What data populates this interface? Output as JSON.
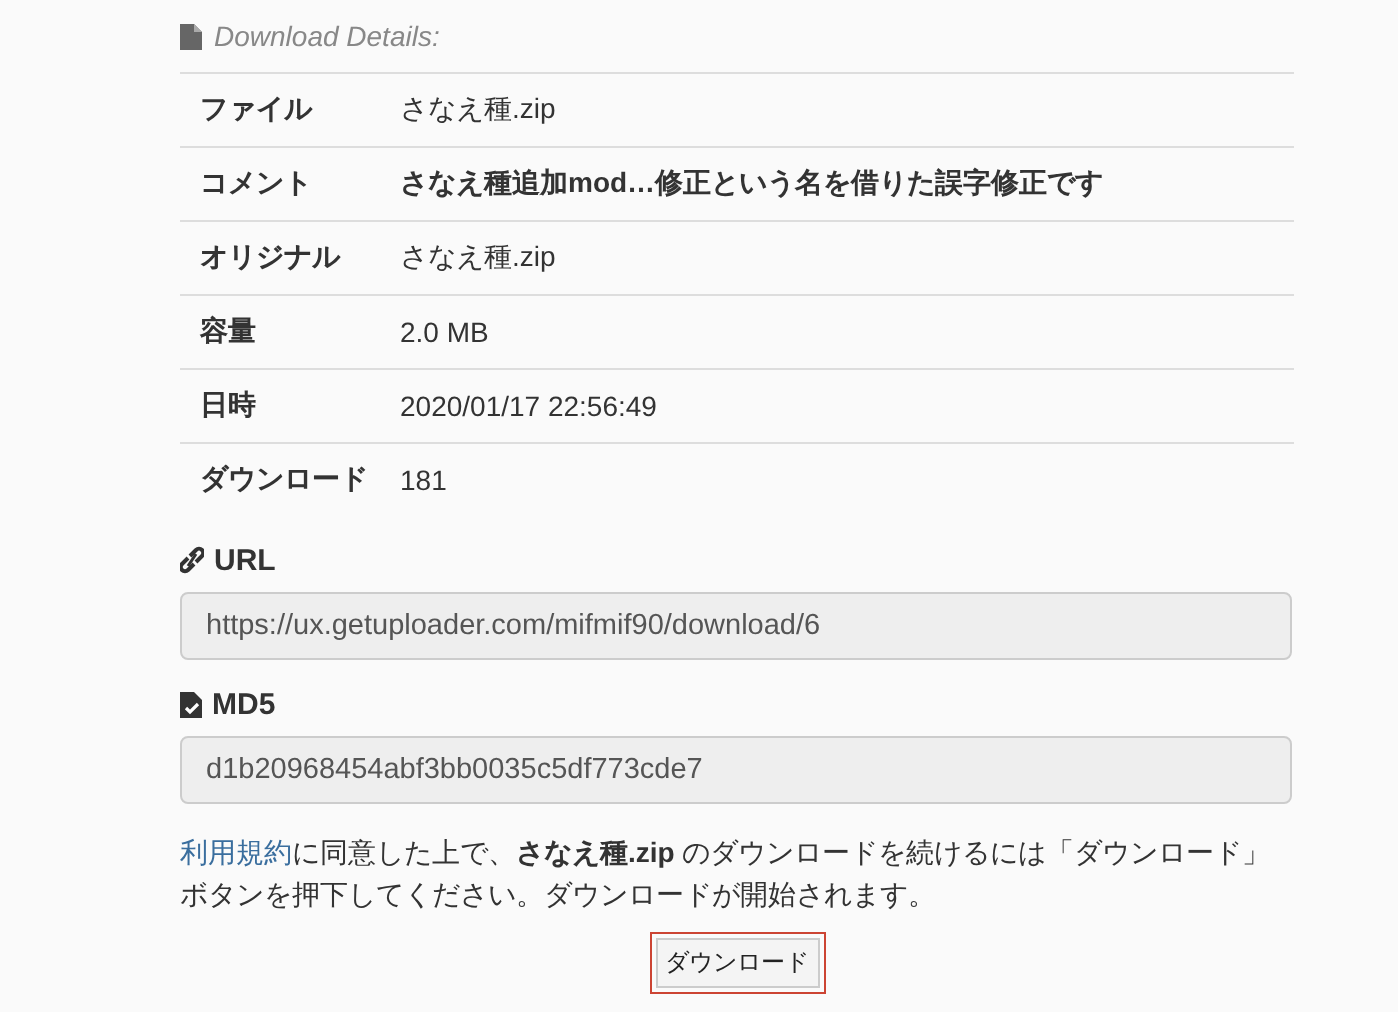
{
  "header": {
    "title": "Download Details:"
  },
  "details": [
    {
      "label": "ファイル",
      "value": "さなえ種.zip",
      "emphasis": false
    },
    {
      "label": "コメント",
      "value": "さなえ種追加mod…修正という名を借りた誤字修正です",
      "emphasis": true
    },
    {
      "label": "オリジナル",
      "value": "さなえ種.zip",
      "emphasis": false
    },
    {
      "label": "容量",
      "value": "2.0 MB",
      "emphasis": false
    },
    {
      "label": "日時",
      "value": "2020/01/17 22:56:49",
      "emphasis": false
    },
    {
      "label": "ダウンロード",
      "value": "181",
      "emphasis": false
    }
  ],
  "fields": [
    {
      "kind": "link",
      "label": "URL",
      "value": "https://ux.getuploader.com/mifmif90/download/6"
    },
    {
      "kind": "hash",
      "label": "MD5",
      "value": "d1b20968454abf3bb0035c5df773cde7"
    }
  ],
  "notice": {
    "link": "利用規約",
    "text": "に同意した上で、**さなえ種.zip** のダウンロードを続けるには「ダウンロード」ボタンを押下してください。ダウンロードが開始されます。"
  },
  "download_button": {
    "label": "ダウンロード"
  }
}
